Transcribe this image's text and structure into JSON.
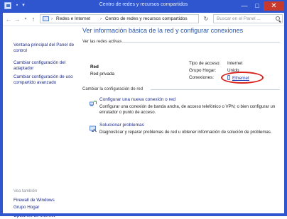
{
  "window": {
    "title": "Centro de redes y recursos compartidos",
    "minimize": "—",
    "maximize": "□",
    "close": "✕"
  },
  "address": {
    "crumbs": [
      "Redes e Internet",
      "Centro de redes y recursos compartidos"
    ],
    "separator": "›",
    "search_placeholder": "Buscar en el Panel ..."
  },
  "sidebar": {
    "links": [
      "Ventana principal del Panel de control",
      "Cambiar configuración del adaptador",
      "Cambiar configuración de uso compartido avanzado"
    ],
    "see_also_title": "Vea también",
    "see_also": [
      "Firewall de Windows",
      "Grupo Hogar",
      "Opciones de Internet"
    ]
  },
  "main": {
    "heading": "Ver información básica de la red y configurar conexiones",
    "active_networks_label": "Ver las redes activas",
    "network": {
      "name": "Red",
      "type": "Red privada",
      "access_type_label": "Tipo de acceso:",
      "access_type_value": "Internet",
      "homegroup_label": "Grupo Hogar:",
      "homegroup_value": "Unido",
      "connections_label": "Conexiones:",
      "connection": "Ethernet"
    },
    "change_settings_label": "Cambiar la configuración de red",
    "tasks": [
      {
        "link": "Configurar una nueva conexión o red",
        "desc": "Configurar una conexión de banda ancha, de acceso telefónico o VPN; o bien configurar un enrutador o punto de acceso."
      },
      {
        "link": "Solucionar problemas",
        "desc": "Diagnosticar y reparar problemas de red u obtener información de solución de problemas."
      }
    ]
  },
  "colors": {
    "frame": "#2f56cf",
    "link": "#1c2a8a",
    "heading": "#2a56a8",
    "highlight": "#d9231d"
  }
}
